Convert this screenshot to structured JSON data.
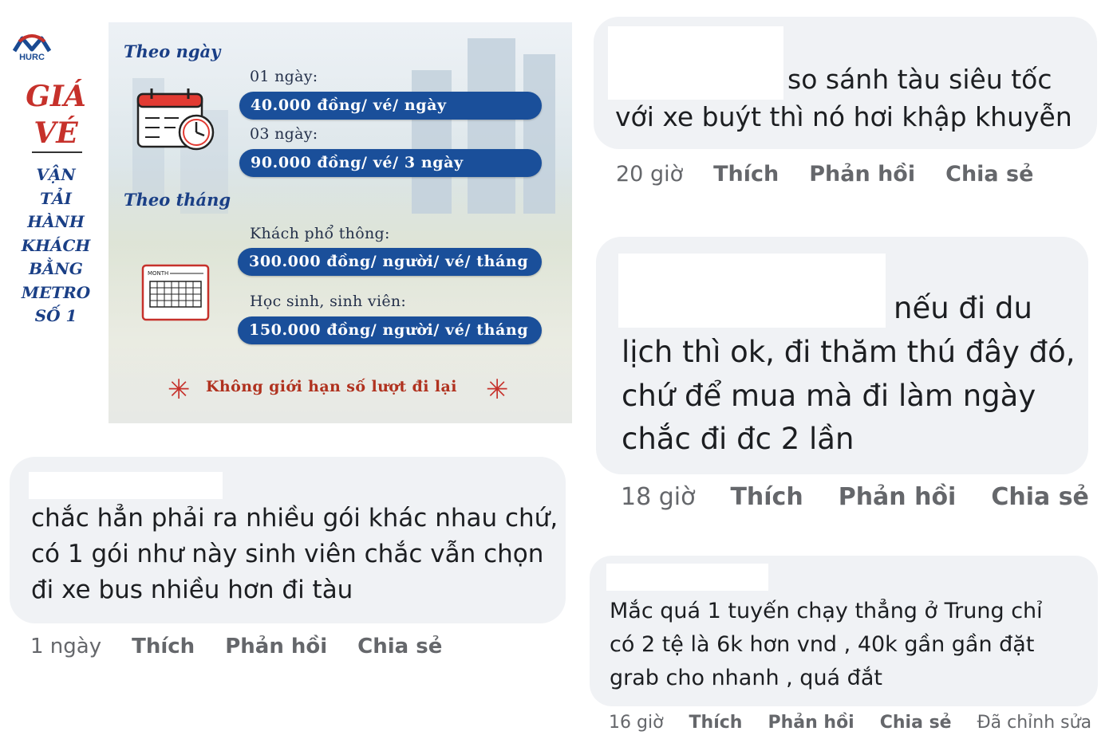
{
  "poster": {
    "logo_text": "HURC",
    "title_line1": "GIÁ",
    "title_line2": "VÉ",
    "subtitle_lines": [
      "VẬN",
      "TẢI",
      "HÀNH",
      "KHÁCH",
      "BẰNG",
      "METRO",
      "SỐ 1"
    ],
    "theo_ngay": "Theo ngày",
    "theo_thang": "Theo tháng",
    "prices": [
      {
        "caption": "01 ngày:",
        "value": "40.000 đồng/ vé/ ngày"
      },
      {
        "caption": "03 ngày:",
        "value": "90.000 đồng/ vé/ 3 ngày"
      },
      {
        "caption": "Khách phổ thông:",
        "value": "300.000 đồng/ người/ vé/ tháng"
      },
      {
        "caption": "Học sinh, sinh viên:",
        "value": "150.000 đồng/ người/ vé/ tháng"
      }
    ],
    "calendar_month_label": "MONTH",
    "note": "Không giới hạn số lượt đi lại",
    "colors": {
      "red": "#c6312b",
      "blue": "#1a4f9a",
      "navy": "#1a3f86"
    }
  },
  "comments": [
    {
      "lines": [
        "so sánh tàu siêu tốc",
        "với xe buýt thì nó hơi khập khuyễn"
      ],
      "time": "20 giờ",
      "like": "Thích",
      "reply": "Phản hồi",
      "share": "Chia sẻ"
    },
    {
      "lines": [
        "nếu đi du",
        "lịch thì ok, đi thăm thú đây đó,",
        "chứ để mua mà đi làm ngày",
        "chắc đi đc 2 lần"
      ],
      "time": "18 giờ",
      "like": "Thích",
      "reply": "Phản hồi",
      "share": "Chia sẻ"
    },
    {
      "lines": [
        "chắc hẳn phải ra nhiều gói khác nhau chứ,",
        "có 1 gói như này sinh viên chắc vẫn chọn",
        "đi xe bus nhiều hơn đi tàu"
      ],
      "time": "1 ngày",
      "like": "Thích",
      "reply": "Phản hồi",
      "share": "Chia sẻ"
    },
    {
      "lines": [
        "Mắc quá 1 tuyến chạy thẳng ở Trung chỉ",
        "có 2 tệ là 6k hơn vnd , 40k gần gần đặt",
        "grab cho nhanh , quá đắt"
      ],
      "time": "16 giờ",
      "like": "Thích",
      "reply": "Phản hồi",
      "share": "Chia sẻ",
      "edited": "Đã chỉnh sửa"
    }
  ],
  "colors": {
    "bubble": "#f0f2f5",
    "meta_text": "#65676b",
    "comment_text": "#1c1e21"
  }
}
